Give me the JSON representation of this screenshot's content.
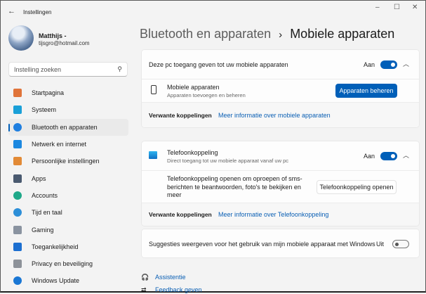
{
  "window": {
    "title": "Instellingen"
  },
  "user": {
    "name": "Matthijs -",
    "email": "tijsgro@hotmail.com"
  },
  "search": {
    "placeholder": "Instelling zoeken"
  },
  "sidebar": {
    "items": [
      {
        "label": "Startpagina",
        "icon": "home-icon",
        "color": "#e0743a"
      },
      {
        "label": "Systeem",
        "icon": "system-icon",
        "color": "#1aa0d8"
      },
      {
        "label": "Bluetooth en apparaten",
        "icon": "bluetooth-icon",
        "color": "#1f7fe0",
        "active": true
      },
      {
        "label": "Netwerk en internet",
        "icon": "wifi-icon",
        "color": "#1c88e0"
      },
      {
        "label": "Persoonlijke instellingen",
        "icon": "brush-icon",
        "color": "#e28a36"
      },
      {
        "label": "Apps",
        "icon": "apps-icon",
        "color": "#4a5a70"
      },
      {
        "label": "Accounts",
        "icon": "account-icon",
        "color": "#1fa889"
      },
      {
        "label": "Tijd en taal",
        "icon": "clock-globe-icon",
        "color": "#2d8fd8"
      },
      {
        "label": "Gaming",
        "icon": "gamepad-icon",
        "color": "#8a93a0"
      },
      {
        "label": "Toegankelijkheid",
        "icon": "accessibility-icon",
        "color": "#1c6fd0"
      },
      {
        "label": "Privacy en beveiliging",
        "icon": "shield-icon",
        "color": "#8d9299"
      },
      {
        "label": "Windows Update",
        "icon": "update-icon",
        "color": "#1a77d4"
      }
    ]
  },
  "breadcrumb": {
    "parent": "Bluetooth en apparaten",
    "sep": "›",
    "current": "Mobiele apparaten"
  },
  "card1": {
    "title": "Deze pc toegang geven tot uw mobiele apparaten",
    "state": "Aan",
    "toggle_on": true,
    "item_title": "Mobiele apparaten",
    "item_sub": "Apparaten toevoegen en beheren",
    "button": "Apparaten beheren",
    "related_label": "Verwante koppelingen",
    "related_link": "Meer informatie over mobiele apparaten"
  },
  "card2": {
    "title": "Telefoonkoppeling",
    "sub": "Direct toegang tot uw mobiele apparaat vanaf uw pc",
    "state": "Aan",
    "toggle_on": true,
    "desc": "Telefoonkoppeling openen om oproepen of sms-berichten te beantwoorden, foto's te bekijken en meer",
    "button": "Telefoonkoppeling openen",
    "related_label": "Verwante koppelingen",
    "related_link": "Meer informatie over Telefoonkoppeling"
  },
  "card3": {
    "title": "Suggesties weergeven voor het gebruik van mijn mobiele apparaat met Windows",
    "state": "Uit",
    "toggle_on": false
  },
  "footer": {
    "help": "Assistentie",
    "feedback": "Feedback geven"
  },
  "colors": {
    "accent": "#005fb8",
    "link": "#0a5fb4"
  }
}
